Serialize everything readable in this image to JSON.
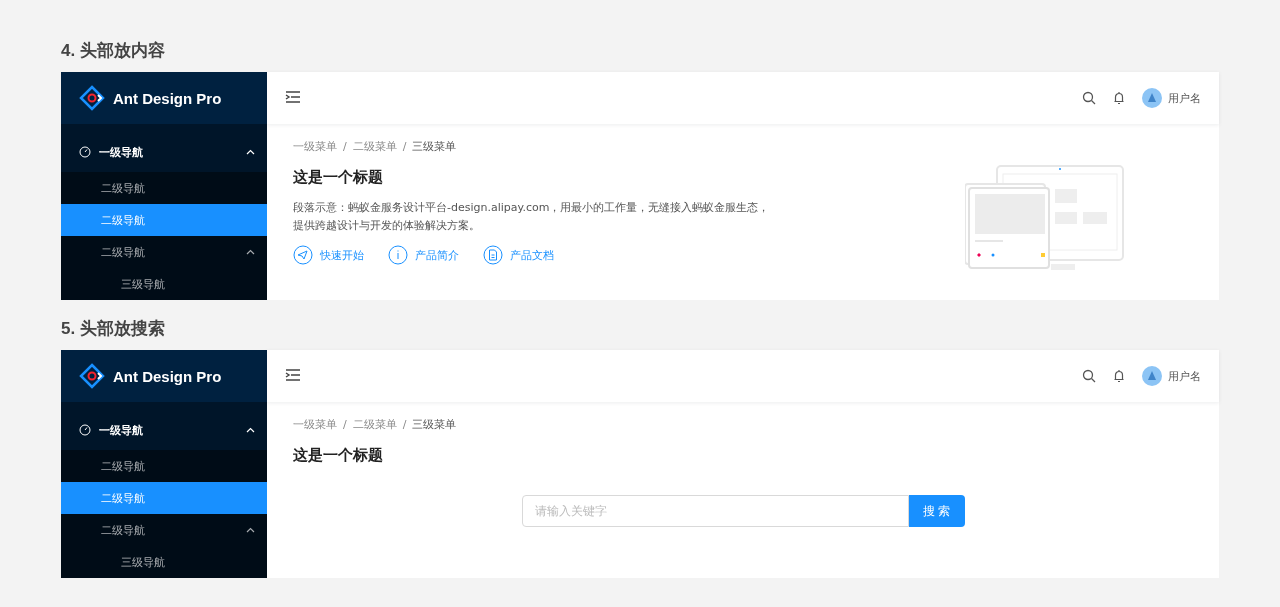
{
  "sections": [
    {
      "title": "4. 头部放内容",
      "kind": "content",
      "logo": "Ant Design Pro",
      "user": "用户名",
      "menu": [
        {
          "label": "一级导航",
          "expanded": true,
          "children": [
            {
              "label": "二级导航",
              "selected": false
            },
            {
              "label": "二级导航",
              "selected": true
            },
            {
              "label": "二级导航",
              "selected": false,
              "expanded": true,
              "children": [
                {
                  "label": "三级导航",
                  "selected": false
                }
              ]
            }
          ]
        }
      ],
      "breadcrumb": {
        "separator": "/",
        "items": [
          "一级菜单",
          "二级菜单",
          "三级菜单"
        ]
      },
      "page_title": "这是一个标题",
      "description": "段落示意：蚂蚁金服务设计平台-design.alipay.com，用最小的工作量，无缝接入蚂蚁金服生态，提供跨越设计与开发的体验解决方案。",
      "links": [
        {
          "label": "快速开始",
          "kind": "send"
        },
        {
          "label": "产品简介",
          "kind": "info"
        },
        {
          "label": "产品文档",
          "kind": "doc"
        }
      ]
    },
    {
      "title": "5. 头部放搜索",
      "kind": "search",
      "logo": "Ant Design Pro",
      "user": "用户名",
      "menu": [
        {
          "label": "一级导航",
          "expanded": true,
          "children": [
            {
              "label": "二级导航",
              "selected": false
            },
            {
              "label": "二级导航",
              "selected": true
            },
            {
              "label": "二级导航",
              "selected": false,
              "expanded": true,
              "children": [
                {
                  "label": "三级导航",
                  "selected": false
                }
              ]
            }
          ]
        }
      ],
      "breadcrumb": {
        "separator": "/",
        "items": [
          "一级菜单",
          "二级菜单",
          "三级菜单"
        ]
      },
      "page_title": "这是一个标题",
      "search": {
        "placeholder": "请输入关键字",
        "button": "搜 索"
      }
    }
  ]
}
